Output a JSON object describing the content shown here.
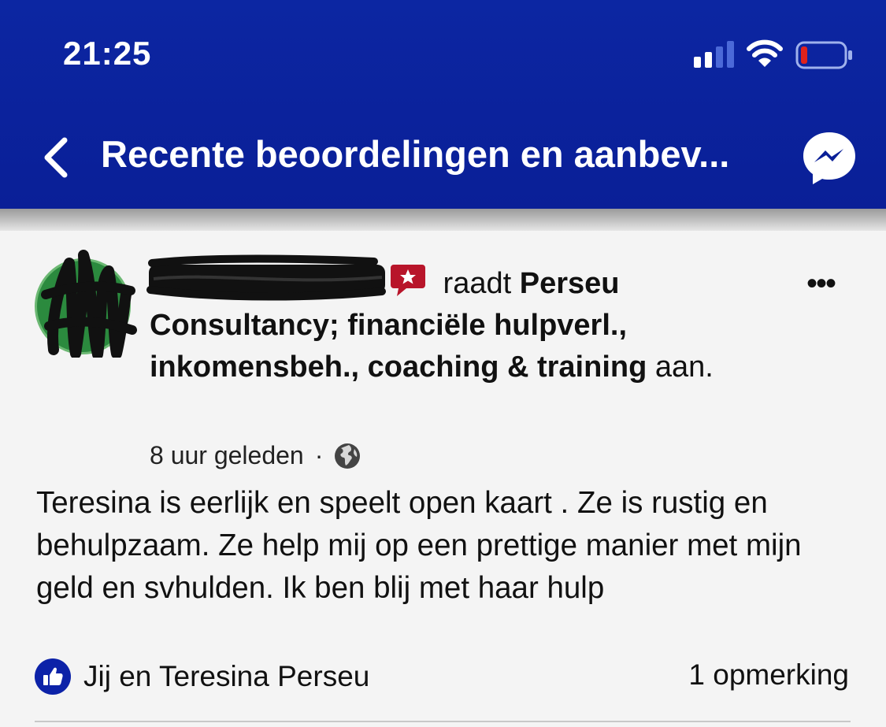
{
  "status_bar": {
    "time": "21:25",
    "signal_bars_filled": 2,
    "signal_bars_total": 4,
    "wifi_icon": "wifi-icon",
    "battery_level": 0.1,
    "battery_color": "#e0221c"
  },
  "header": {
    "title": "Recente beoordelingen en aanbev...",
    "back_icon": "chevron-left-icon",
    "messenger_icon": "messenger-icon",
    "background": "#0a1f97"
  },
  "post": {
    "recommends_text": " raadt ",
    "page_name": "Perseu Consultancy; financiële hulpverl., inkomensbeh., coaching & training",
    "suffix": " aan.",
    "time": "8 uur geleden",
    "separator": "·",
    "privacy_icon": "globe-icon",
    "recommend_icon": "recommendation-icon",
    "recommend_color": "#b8152a",
    "body": "Teresina is eerlijk en speelt open kaart . Ze is rustig en behulpzaam. Ze help mij op een prettige manier met mijn geld en svhulden. Ik ben blij met haar hulp",
    "more_label": "•••"
  },
  "footer": {
    "reactions_text": "Jij en Teresina Perseu",
    "comments_text": "1 opmerking",
    "like_color": "#0c22a8"
  }
}
